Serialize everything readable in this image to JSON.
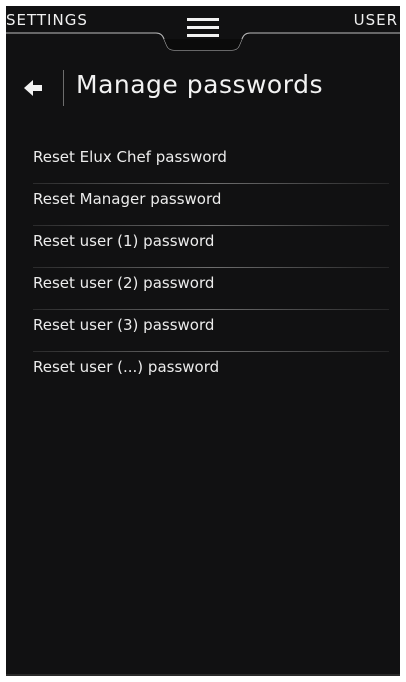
{
  "topbar": {
    "left_label": "SETTINGS",
    "right_label": "USER",
    "menu_icon": "hamburger-menu-icon"
  },
  "header": {
    "back_icon": "arrow-left-icon",
    "title": "Manage passwords"
  },
  "password_items": [
    {
      "label": "Reset Elux Chef password"
    },
    {
      "label": "Reset Manager password"
    },
    {
      "label": "Reset user (1) password"
    },
    {
      "label": "Reset user (2) password"
    },
    {
      "label": "Reset user (3) password"
    },
    {
      "label": "Reset user (...) password"
    }
  ],
  "colors": {
    "background": "#111112",
    "text": "#ededed",
    "divider": "#8a8a8a"
  }
}
